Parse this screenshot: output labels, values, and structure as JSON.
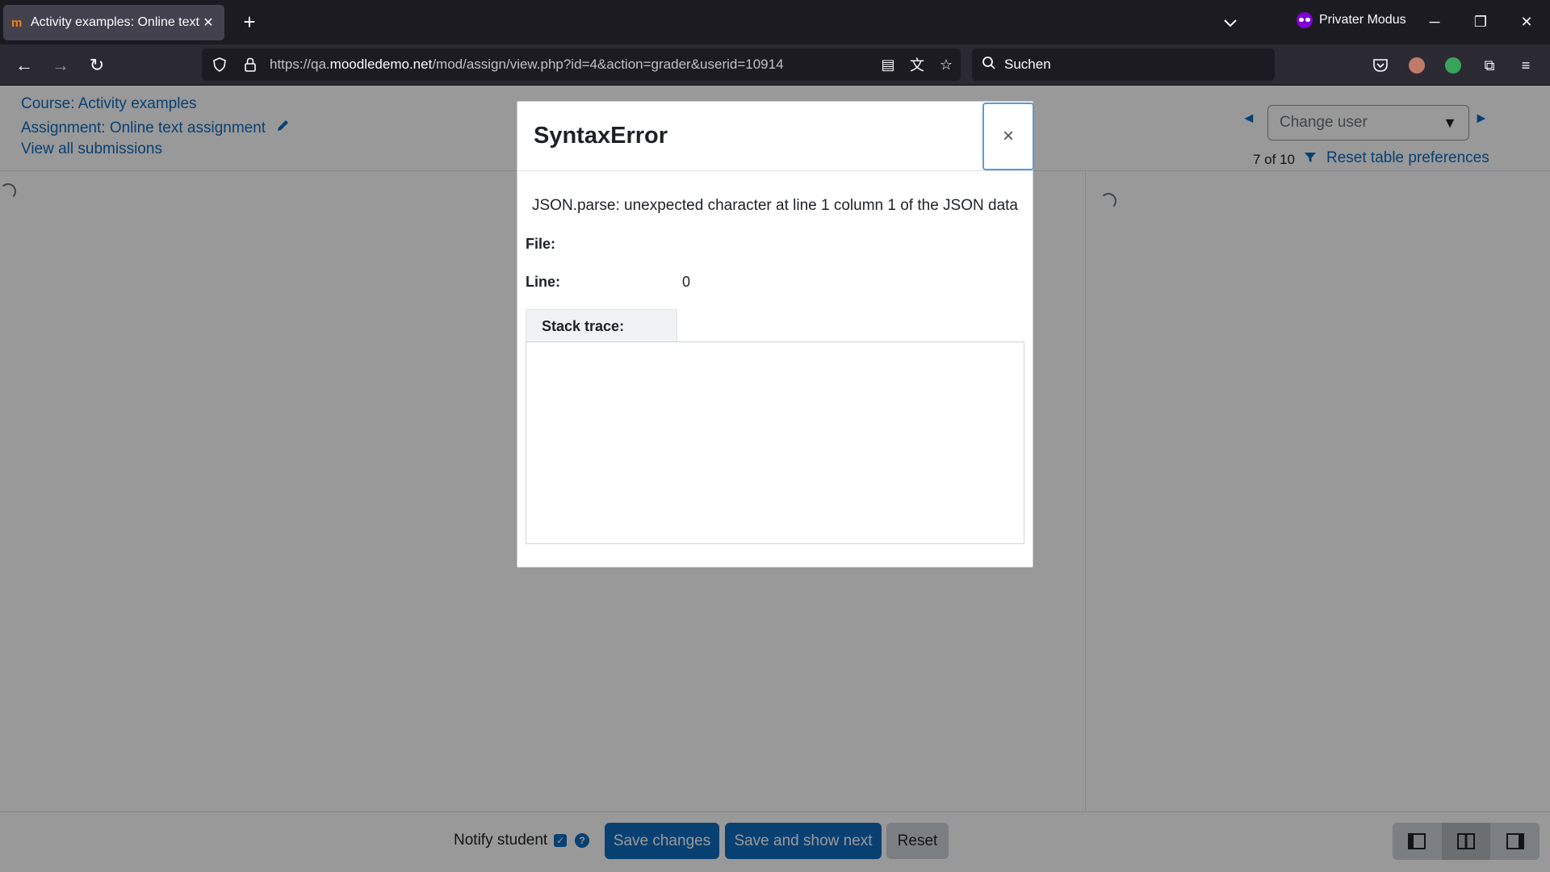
{
  "browser": {
    "tab_title": "Activity examples: Online text assignment",
    "favicon_text": "✨m",
    "private_label": "Privater Modus",
    "url_prefix": "https://qa.",
    "url_domain": "moodledemo.net",
    "url_path": "/mod/assign/view.php?id=4&action=grader&userid=10914",
    "search_placeholder": "Suchen"
  },
  "header": {
    "course_link": "Course: Activity examples",
    "assignment_link": "Assignment: Online text assignment",
    "view_all_link": "View all submissions",
    "change_user_placeholder": "Change user",
    "user_count": "7 of 10",
    "reset_prefs_link": "Reset table preferences"
  },
  "footer": {
    "notify_label": "Notify student",
    "notify_checked": true,
    "save_label": "Save changes",
    "save_next_label": "Save and show next",
    "reset_label": "Reset"
  },
  "modal": {
    "title": "SyntaxError",
    "close_glyph": "×",
    "message": "JSON.parse: unexpected character at line 1 column 1 of the JSON data",
    "file_label": "File:",
    "file_value": "",
    "line_label": "Line:",
    "line_value": "0",
    "stack_label": "Stack trace:",
    "stack_value": ""
  },
  "colors": {
    "moodle_blue": "#0f6cbf",
    "browser_dark": "#1c1b22",
    "private_purple": "#8000d7"
  }
}
